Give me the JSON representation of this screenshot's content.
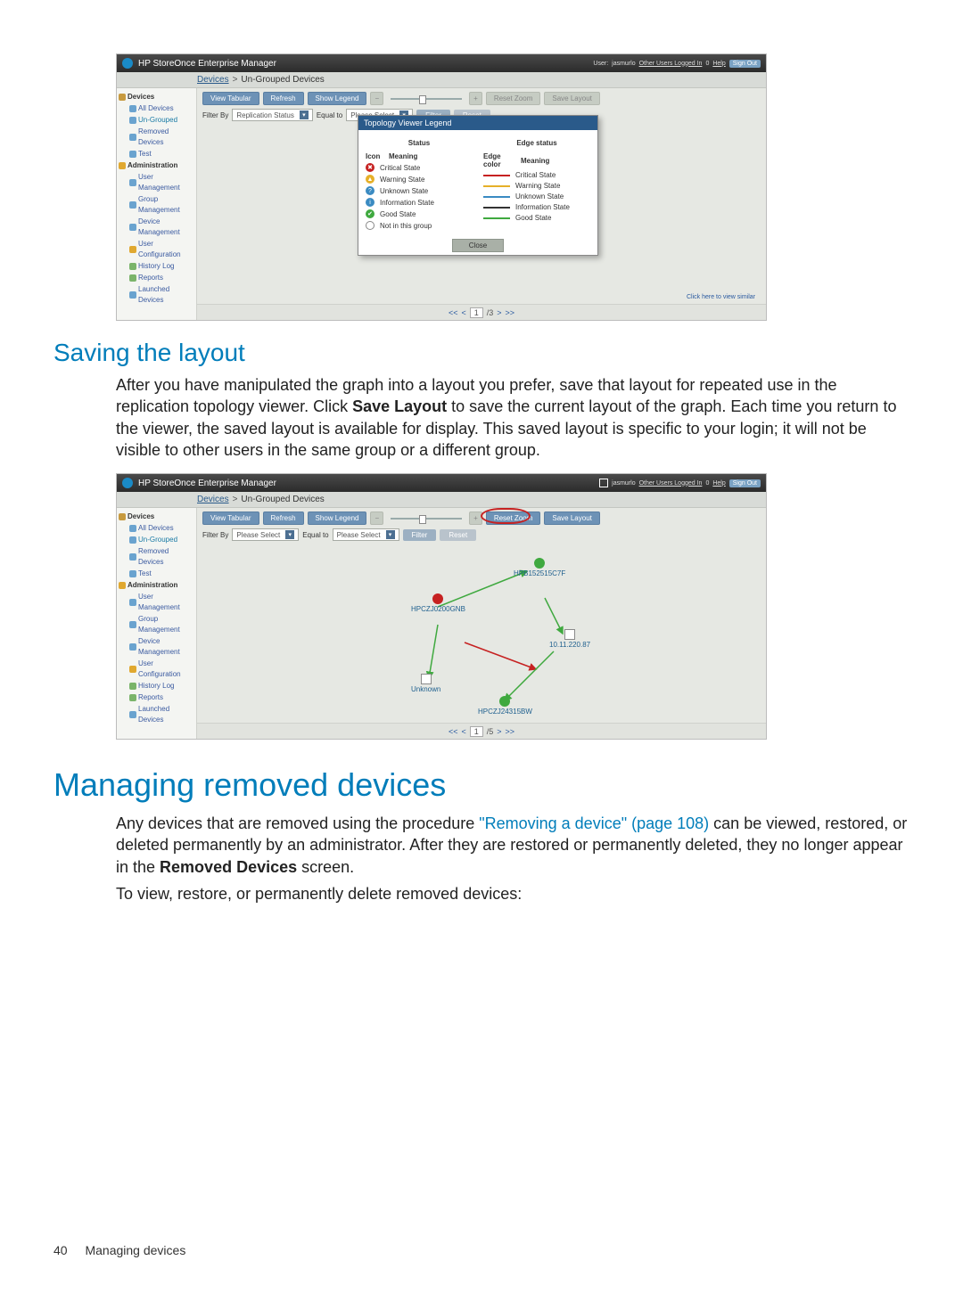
{
  "app": {
    "title": "HP StoreOnce Enterprise Manager",
    "user_label": "User:",
    "user_name": "jasmurlo",
    "other_users": "Other Users Logged In",
    "other_count": "0",
    "help": "Help",
    "signout": "Sign Out"
  },
  "breadcrumb": {
    "root": "Devices",
    "sep": ">",
    "current": "Un-Grouped Devices"
  },
  "nav": {
    "devices": "Devices",
    "all_devices": "All Devices",
    "ungrouped": "Un-Grouped",
    "removed": "Removed Devices",
    "test": "Test",
    "admin": "Administration",
    "user_mgmt": "User Management",
    "group_mgmt": "Group Management",
    "device_mgmt": "Device Management",
    "user_config": "User Configuration",
    "history": "History Log",
    "reports": "Reports",
    "launched": "Launched Devices"
  },
  "toolbar": {
    "view_tabular": "View Tabular",
    "refresh": "Refresh",
    "show_legend": "Show Legend",
    "reset_zoom": "Reset Zoom",
    "save_layout": "Save Layout"
  },
  "filter": {
    "label": "Filter By",
    "sel1_text": "Replication Status",
    "sel1b_text": "Please Select",
    "equal": "Equal to",
    "sel2_text": "Please Select",
    "filter_btn": "Filter",
    "reset_btn": "Reset"
  },
  "legend": {
    "title": "Topology Viewer Legend",
    "status_h": "Status",
    "icon_h": "Icon",
    "meaning_h": "Meaning",
    "edge_h": "Edge status",
    "edgecolor_h": "Edge color",
    "rows": [
      {
        "icon_bg": "#c62121",
        "icon_char": "✖",
        "edge": "#c62121",
        "label": "Critical State"
      },
      {
        "icon_bg": "#e6b029",
        "icon_char": "▲",
        "edge": "#e6b029",
        "label": "Warning State"
      },
      {
        "icon_bg": "#3a8bc2",
        "icon_char": "?",
        "edge": "#3a8bc2",
        "label": "Unknown State"
      },
      {
        "icon_bg": "#3a8bc2",
        "icon_char": "i",
        "edge": "#333333",
        "label": "Information State"
      },
      {
        "icon_bg": "#3fa93f",
        "icon_char": "✔",
        "edge": "#3fa93f",
        "label": "Good State"
      },
      {
        "icon_bg": "#ffffff",
        "icon_char": "",
        "edge": "",
        "label": "Not in this group",
        "icon_border": "#888"
      }
    ],
    "close": "Close",
    "footer_link": "Click here to view similar"
  },
  "pager": {
    "first": "<<",
    "prev": "<",
    "page": "1",
    "total": "/3",
    "next": ">",
    "last": ">>",
    "total2": "/5"
  },
  "graph": {
    "nodes": {
      "a": "HPCZJ0200GNB",
      "b": "HPB152515C7F",
      "c": "10.11.220.87",
      "d": "Unknown",
      "e": "HPCZJ24315BW"
    }
  },
  "doc": {
    "h_saving": "Saving the layout",
    "p_saving_a": "After you have manipulated the graph into a layout you prefer, save that layout for repeated use in the replication topology viewer. Click ",
    "p_saving_b_bold": "Save Layout",
    "p_saving_c": " to save the current layout of the graph. Each time you return to the viewer, the saved layout is available for display. This saved layout is specific to your login; it will not be visible to other users in the same group or a different group.",
    "h_managing": "Managing removed devices",
    "p_managing_a": "Any devices that are removed using the procedure ",
    "p_managing_link": "\"Removing a device\" (page 108)",
    "p_managing_b": " can be viewed, restored, or deleted permanently by an administrator. After they are restored or permanently deleted, they no longer appear in the ",
    "p_managing_bold": "Removed Devices",
    "p_managing_c": " screen.",
    "p_managing2": "To view, restore, or permanently delete removed devices:",
    "footer_page": "40",
    "footer_section": "Managing devices"
  }
}
